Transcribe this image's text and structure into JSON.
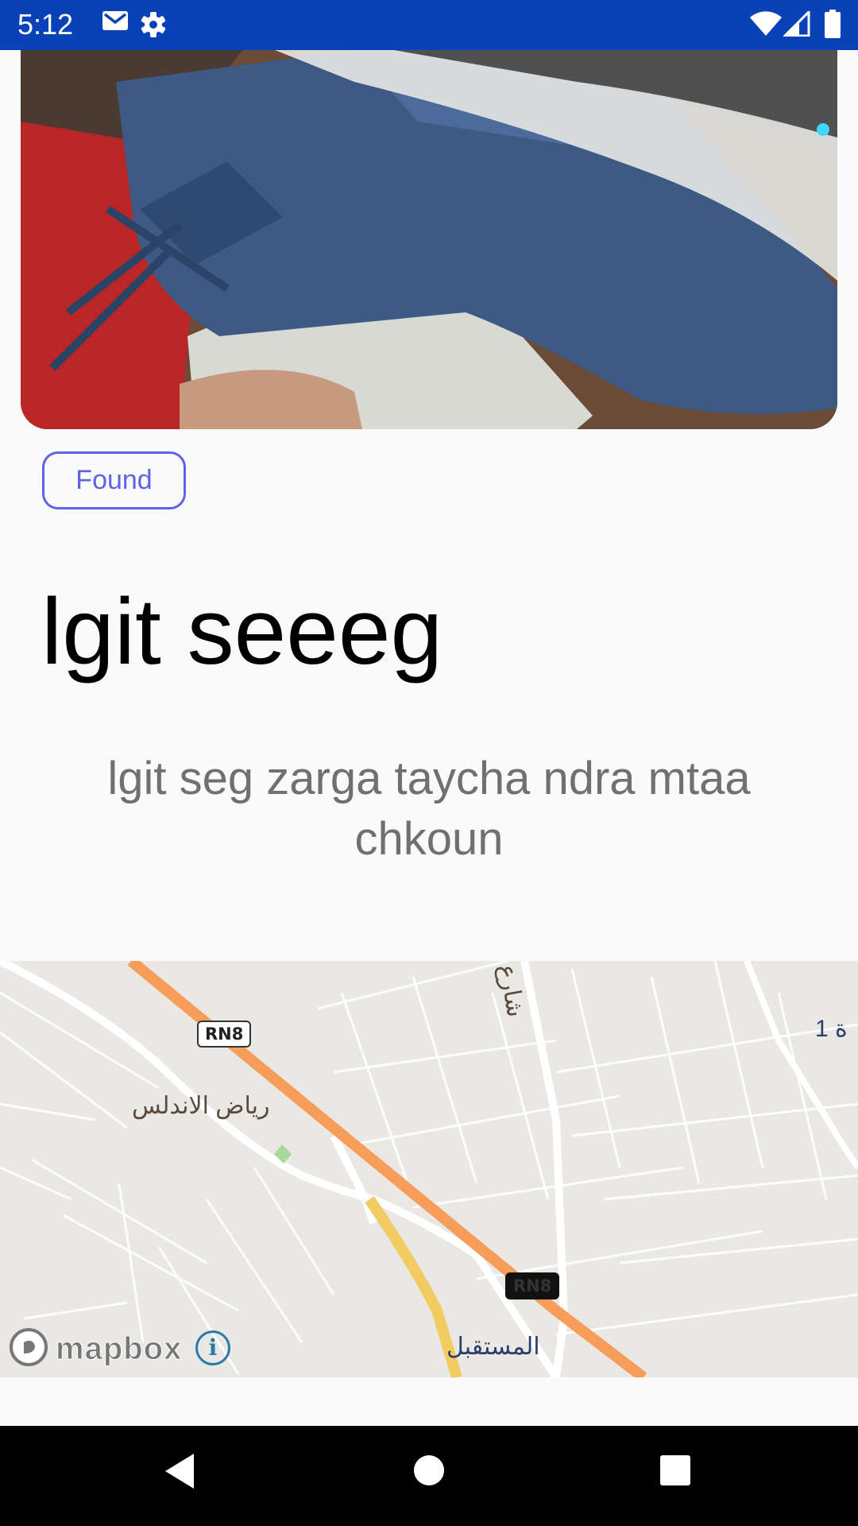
{
  "status_bar": {
    "time": "5:12",
    "icons": [
      "gmail-icon",
      "settings-icon",
      "wifi-icon",
      "cellular-signal-icon",
      "battery-icon"
    ],
    "background_color": "#0842b6"
  },
  "item": {
    "photo_icon": "sneaker-photo",
    "status_chip": "Found",
    "title": "lgit seeeg",
    "description": "lgit seg zarga taycha ndra mtaa chkoun",
    "accent_color": "#5e62e6"
  },
  "map": {
    "place_labels": [
      "رياض الاندلس",
      "المستقبل",
      "شارع",
      "ة 1"
    ],
    "road_shields": [
      "RN8",
      "RN8"
    ],
    "attribution": "mapbox",
    "info_icon": "i"
  },
  "nav_bar": {
    "icons": [
      "back-icon",
      "home-icon",
      "recents-icon"
    ]
  }
}
